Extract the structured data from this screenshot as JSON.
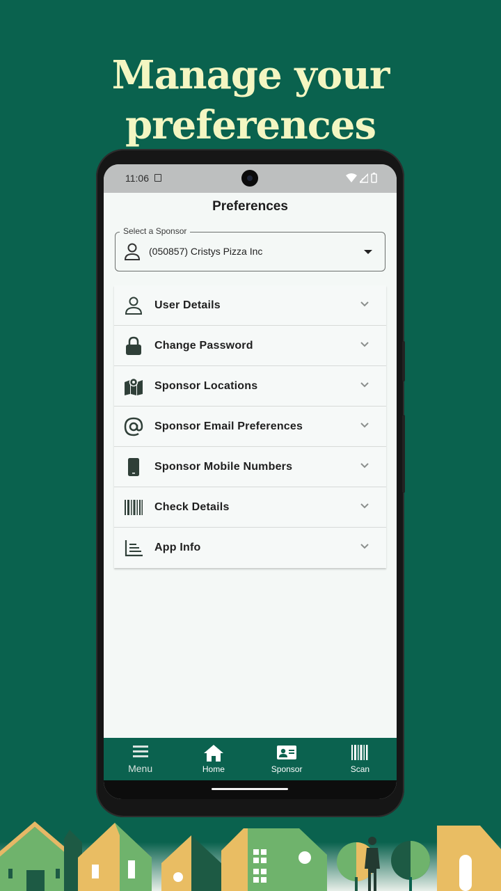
{
  "promo": {
    "headline_line1": "Manage your",
    "headline_line2": "preferences"
  },
  "status_bar": {
    "time": "11:06"
  },
  "app": {
    "title": "Preferences"
  },
  "sponsor_select": {
    "label": "Select a Sponsor",
    "value": "(050857) Cristys Pizza Inc"
  },
  "preferences": [
    {
      "label": "User Details",
      "icon": "person-icon"
    },
    {
      "label": "Change Password",
      "icon": "lock-icon"
    },
    {
      "label": " Sponsor Locations",
      "icon": "map-icon"
    },
    {
      "label": "Sponsor Email Preferences",
      "icon": "at-sign-icon"
    },
    {
      "label": "Sponsor Mobile Numbers",
      "icon": "mobile-phone-icon"
    },
    {
      "label": "Check Details",
      "icon": "barcode-icon"
    },
    {
      "label": "App Info",
      "icon": "chart-icon"
    }
  ],
  "nav": {
    "menu": "Menu",
    "home": "Home",
    "sponsor": "Sponsor",
    "scan": "Scan"
  },
  "colors": {
    "background": "#0a624e",
    "headline": "#f4f6c2",
    "navbar": "#0b624f",
    "screen": "#f4f8f6"
  }
}
